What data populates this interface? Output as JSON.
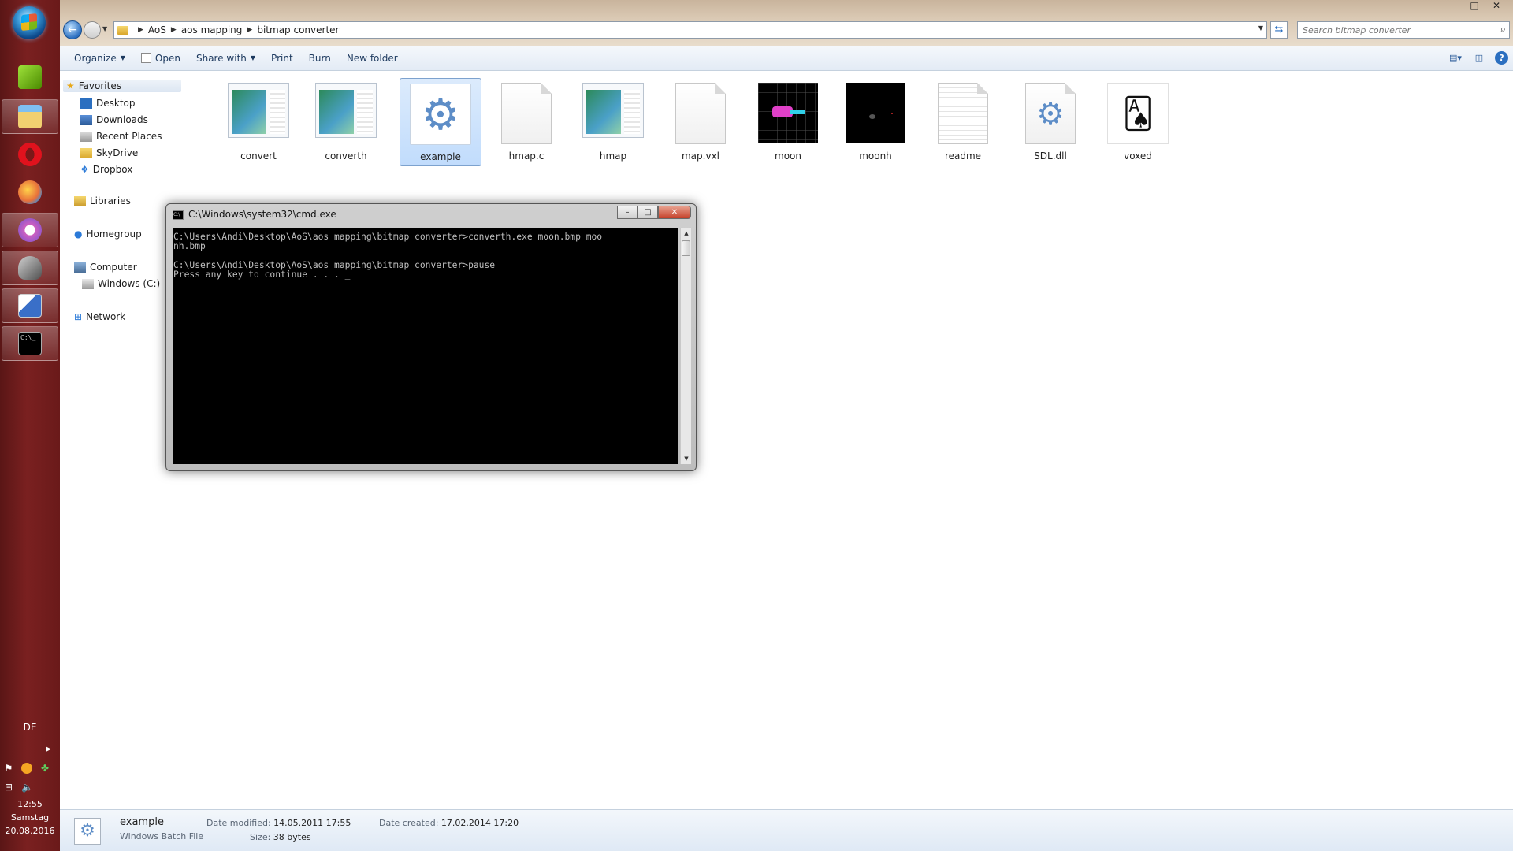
{
  "taskbar": {
    "language": "DE",
    "time": "12:55",
    "day": "Samstag",
    "date": "20.08.2016",
    "apps": [
      {
        "name": "nvidia-icon",
        "color": "#76b900"
      },
      {
        "name": "file-explorer-icon",
        "color": "#e8c050"
      },
      {
        "name": "opera-icon",
        "color": "#e0121d"
      },
      {
        "name": "paint-icon",
        "color": "#e8703a"
      },
      {
        "name": "itunes-icon",
        "color": "#d060c0"
      },
      {
        "name": "media-player-icon",
        "color": "#a0a0a0"
      },
      {
        "name": "paint-editor-icon",
        "color": "#3a6fc8"
      },
      {
        "name": "cmd-icon",
        "color": "#000000"
      }
    ]
  },
  "window": {
    "title_controls": [
      "–",
      "□",
      "✕"
    ]
  },
  "address": {
    "crumbs": [
      "AoS",
      "aos mapping",
      "bitmap converter"
    ],
    "search_placeholder": "Search bitmap converter"
  },
  "commandbar": {
    "organize": "Organize",
    "open": "Open",
    "share_with": "Share with",
    "print": "Print",
    "burn": "Burn",
    "new_folder": "New folder"
  },
  "navpane": {
    "favorites": "Favorites",
    "desktop": "Desktop",
    "downloads": "Downloads",
    "recent_places": "Recent Places",
    "skydrive": "SkyDrive",
    "dropbox": "Dropbox",
    "libraries": "Libraries",
    "homegroup": "Homegroup",
    "computer": "Computer",
    "windows_c": "Windows (C:)",
    "network": "Network"
  },
  "files": [
    {
      "name": "convert",
      "kind": "app"
    },
    {
      "name": "converth",
      "kind": "app"
    },
    {
      "name": "example",
      "kind": "batch",
      "selected": true
    },
    {
      "name": "hmap.c",
      "kind": "doc"
    },
    {
      "name": "hmap",
      "kind": "app"
    },
    {
      "name": "map.vxl",
      "kind": "doc"
    },
    {
      "name": "moon",
      "kind": "image-moon"
    },
    {
      "name": "moonh",
      "kind": "image-moonh"
    },
    {
      "name": "readme",
      "kind": "text"
    },
    {
      "name": "SDL.dll",
      "kind": "dll"
    },
    {
      "name": "voxed",
      "kind": "card"
    }
  ],
  "details": {
    "name": "example",
    "type": "Windows Batch File",
    "date_modified_label": "Date modified:",
    "date_modified": "14.05.2011 17:55",
    "size_label": "Size:",
    "size": "38 bytes",
    "date_created_label": "Date created:",
    "date_created": "17.02.2014 17:20"
  },
  "cmd": {
    "title": "C:\\Windows\\system32\\cmd.exe",
    "output": "C:\\Users\\Andi\\Desktop\\AoS\\aos mapping\\bitmap converter>converth.exe moon.bmp moo\nnh.bmp\n\nC:\\Users\\Andi\\Desktop\\AoS\\aos mapping\\bitmap converter>pause\nPress any key to continue . . . _"
  }
}
